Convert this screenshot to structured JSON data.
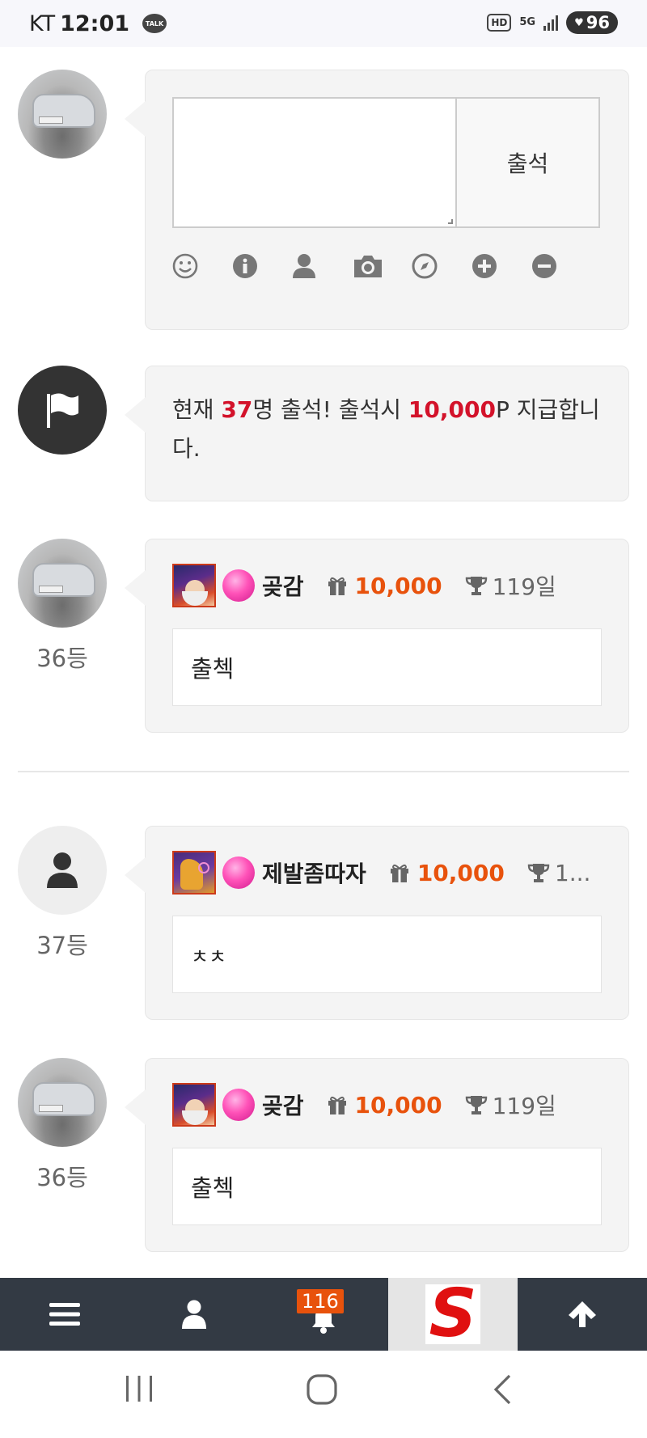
{
  "status_bar": {
    "carrier": "KT",
    "time": "12:01",
    "talk_label": "TALK",
    "hd_label": "HD",
    "network_label": "5G",
    "battery": "96"
  },
  "composer": {
    "textarea_placeholder": "",
    "checkin_label": "출석",
    "tools": [
      "smile-icon",
      "info-icon",
      "user-icon",
      "camera-icon",
      "compass-icon",
      "plus-circle-icon",
      "minus-circle-icon"
    ]
  },
  "notice": {
    "part1": "현재 ",
    "count": "37",
    "part2": "명 출석! 출석시 ",
    "points": "10,000",
    "part3": "P 지급합니다."
  },
  "entries": [
    {
      "rank": "36등",
      "nickname": "곶감",
      "points": "10,000",
      "days": "119일",
      "message": "출첵"
    },
    {
      "rank": "37등",
      "nickname": "제발좀따자",
      "points": "10,000",
      "days": "1...",
      "message": "ㅊㅊ"
    },
    {
      "rank": "36등",
      "nickname": "곶감",
      "points": "10,000",
      "days": "119일",
      "message": "출첵"
    }
  ],
  "bottom_nav": {
    "notification_count": "116",
    "logo_letter": "S"
  },
  "colors": {
    "accent_red": "#d3122a",
    "points_orange": "#e8520c",
    "nav_bg": "#333a44"
  }
}
